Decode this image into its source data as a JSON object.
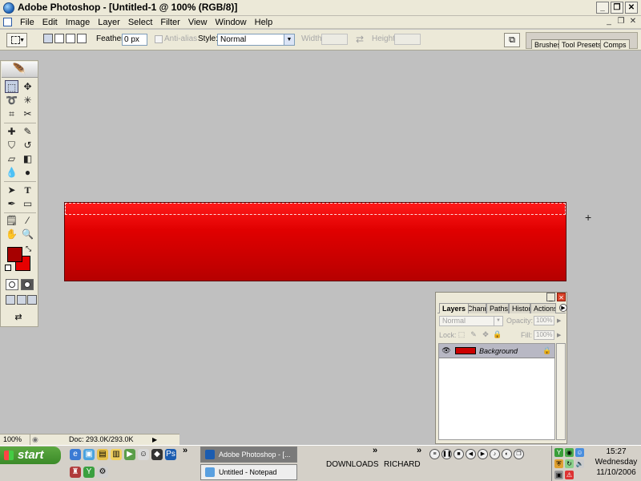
{
  "window": {
    "title": "Adobe Photoshop - [Untitled-1 @ 100% (RGB/8)]",
    "controls": [
      "_",
      "❐",
      "✕"
    ]
  },
  "menubar": {
    "items": [
      "File",
      "Edit",
      "Image",
      "Layer",
      "Select",
      "Filter",
      "View",
      "Window",
      "Help"
    ],
    "doc_controls": [
      "_",
      "❐",
      "✕"
    ]
  },
  "options_bar": {
    "feather_label": "Feather:",
    "feather_value": "0 px",
    "antialias_label": "Anti-alias",
    "style_label": "Style:",
    "style_value": "Normal",
    "width_label": "Width:",
    "height_label": "Height:",
    "palette_well_tabs": [
      "Brushes",
      "Tool Presets",
      "Comps"
    ]
  },
  "toolbox": {
    "foreground_color": "#a60000",
    "background_color": "#e60000",
    "tools": [
      "rectangular-marquee",
      "move",
      "lasso",
      "magic-wand",
      "crop",
      "slice",
      "healing-brush",
      "brush",
      "clone-stamp",
      "history-brush",
      "eraser",
      "gradient",
      "blur",
      "dodge",
      "path-selection",
      "type",
      "pen",
      "rectangle",
      "notes",
      "eyedropper",
      "hand",
      "zoom"
    ]
  },
  "canvas": {
    "fill_top": "#ff1a1a",
    "fill_bottom": "#b50000"
  },
  "layers_palette": {
    "tabs": [
      "Layers",
      "Channels",
      "Paths",
      "History",
      "Actions"
    ],
    "blend_mode": "Normal",
    "opacity_label": "Opacity:",
    "opacity_value": "100%",
    "lock_label": "Lock:",
    "fill_label": "Fill:",
    "fill_value": "100%",
    "layers": [
      {
        "name": "Background",
        "visible": true,
        "locked": true,
        "thumb_color": "#cc0000"
      }
    ]
  },
  "status_bar": {
    "zoom": "100%",
    "doc_size": "Doc: 293.0K/293.0K"
  },
  "taskbar": {
    "start_label": "start",
    "tasks": [
      {
        "label": "Adobe Photoshop - [...",
        "active": true
      },
      {
        "label": "Untitled - Notepad",
        "active": false
      }
    ],
    "toolbars": [
      "DOWNLOADS",
      "RICHARD"
    ],
    "clock_time": "15:27",
    "clock_day": "Wednesday",
    "clock_date": "11/10/2006"
  }
}
